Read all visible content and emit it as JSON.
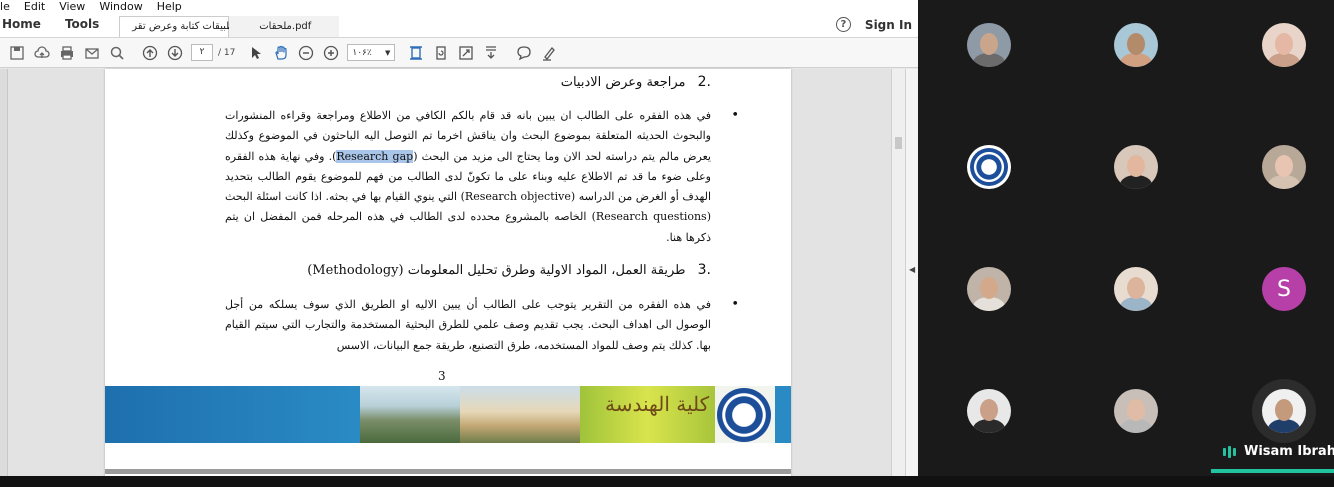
{
  "menu": [
    "ile",
    "Edit",
    "View",
    "Window",
    "Help"
  ],
  "nav": {
    "home": "Home",
    "tools": "Tools"
  },
  "tabs": [
    {
      "label": "تطبيقات كتابة وعرض تقر...",
      "close": "×"
    },
    {
      "label": "ملحقات.pdf"
    }
  ],
  "signin": "Sign In",
  "help_glyph": "?",
  "toolbar": {
    "page_current": "۲",
    "page_total": "/ 17",
    "zoom": "۱۰۶٪"
  },
  "document": {
    "heading2": {
      "num": ".2",
      "text": "مراجعة وعرض الادبيات"
    },
    "para1_a": "في هذه الفقره على الطالب ان يبين بانه قد قام بالكم الكافي من الاطلاع ومراجعة وقراءه المنشورات والبحوث الحديثه المتعلقة بموضوع البحث وان يناقش اخرما تم التوصل اليه الباحثون في الموضوع وكذلك يعرض مالم يتم دراسته لحد الان وما يحتاج الى مزيد من البحث (",
    "para1_hl": "Research gap",
    "para1_b": "). وفي نهاية هذه الفقره وعلى ضوء ما قد تم الاطلاع عليه وبناء على ما تكونّ لدى الطالب من فهم للموضوع يقوم الطالب بتحديد الهدف أو الغرض من الدراسه (Research objective) التي ينوي القيام بها في بحثه. اذا كانت اسئلة البحث (Research questions) الخاصه بالمشروع محدده لدى الطالب في هذه المرحله فمن المفضل ان يتم ذكرها هنا.",
    "heading3": {
      "num": ".3",
      "text": "طريقة العمل، المواد الاولية وطرق تحليل المعلومات (Methodology)"
    },
    "para2": "في هذه الفقره من التقرير يتوجب على الطالب أن يبين الاليه او الطريق الذي سوف يسلكه من أجل الوصول الى اهداف البحث. يجب تقديم وصف علمي للطرق البحثية المستخدمة والتجارب التي سيتم القيام بها. كذلك يتم وصف للمواد المستخدمه، طرق التصنيع، طريقة جمع البيانات، الاسس",
    "bullet": "•",
    "page_number": "3",
    "banner_text": "كلية الهندسة"
  },
  "participants": [
    {
      "id": "p1",
      "kind": "video",
      "skin": "#c9a58b",
      "cloth": "#6b6b6b",
      "bg": "#8e9aa6"
    },
    {
      "id": "p2",
      "kind": "video",
      "skin": "#b38a6a",
      "cloth": "#d0a080",
      "bg": "#a8c8d8"
    },
    {
      "id": "p3",
      "kind": "video",
      "skin": "#e4b8a4",
      "cloth": "#caa08a",
      "bg": "#e8d4c8"
    },
    {
      "id": "p4",
      "kind": "logo",
      "skin": "#ffffff",
      "cloth": "#1d4e9a",
      "bg": "#ffffff"
    },
    {
      "id": "p5",
      "kind": "video",
      "skin": "#e2b79e",
      "cloth": "#222222",
      "bg": "#d8c8bc"
    },
    {
      "id": "p6",
      "kind": "video",
      "skin": "#e8c4b2",
      "cloth": "#d6c2b0",
      "bg": "#b8a898"
    },
    {
      "id": "p7",
      "kind": "video",
      "skin": "#d4a88a",
      "cloth": "#e6e0da",
      "bg": "#c0b4a8"
    },
    {
      "id": "p8",
      "kind": "video",
      "skin": "#dcb49c",
      "cloth": "#9cb4c8",
      "bg": "#e8dcd0"
    },
    {
      "id": "p9",
      "kind": "initial",
      "initial": "S"
    },
    {
      "id": "p10",
      "kind": "video",
      "skin": "#caa088",
      "cloth": "#2a2a2a",
      "bg": "#e8e8e8"
    },
    {
      "id": "p11",
      "kind": "video",
      "skin": "#e0bca6",
      "cloth": "#b8b8b8",
      "bg": "#c8c0b8"
    },
    {
      "id": "p12",
      "kind": "video",
      "skin": "#c49a7c",
      "cloth": "#1f3f6a",
      "bg": "#f0f0f0"
    }
  ],
  "active_speaker": "Wisam Ibrahi",
  "colors": {
    "accent": "#22c4a0",
    "initial_avatar": "#b640a8",
    "highlight": "#a9c6ea"
  }
}
